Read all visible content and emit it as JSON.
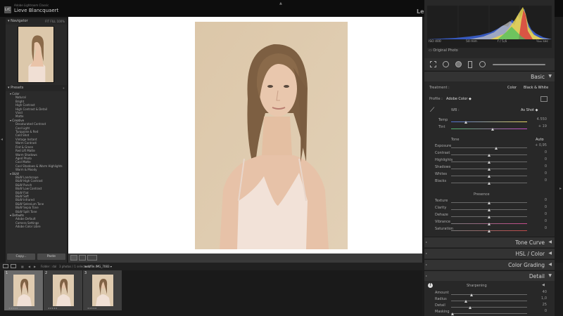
{
  "app": {
    "badge": "LrC",
    "title": "Adobe Lightroom Classic",
    "user": "Lieve Blancquaert",
    "module_hint": "Le"
  },
  "left_panel": {
    "navigator_title": "Navigator",
    "zoom_options": [
      "FIT",
      "FILL",
      "100%"
    ],
    "presets_title": "Presets",
    "groups": [
      {
        "name": "Color",
        "items": [
          "Natural",
          "Bright",
          "High Contrast",
          "High Contrast & Detail",
          "Vivid",
          "Matte"
        ]
      },
      {
        "name": "Creative",
        "items": [
          "Desaturated Contrast",
          "Cool Light",
          "Turquoise & Red",
          "Cold Shot",
          "Vintage Instant",
          "Warm Contrast",
          "Flat & Green",
          "Red Lift Matte",
          "Warm Shadows",
          "Aged Photo",
          "Cool Matte",
          "Cool Shadows & Warm Highlights",
          "Warm & Moody"
        ]
      },
      {
        "name": "B&W",
        "items": [
          "B&W Landscape",
          "B&W High Contrast",
          "B&W Punch",
          "B&W Low Contrast",
          "B&W Flat",
          "B&W Soft",
          "B&W Infrared",
          "B&W Selenium Tone",
          "B&W Sepia Tone",
          "B&W Split Tone"
        ]
      },
      {
        "name": "Defaults",
        "items": [
          "Adobe Default",
          "Camera Settings",
          "Adobe Color Libre"
        ]
      }
    ],
    "copy_label": "Copy...",
    "paste_label": "Paste"
  },
  "filmstrip_bar": {
    "folder_label": "Folder : dal",
    "count_text": "3 photos / 1 selected /",
    "filename": "webfile.IMG_7083 ▾"
  },
  "filmstrip": {
    "thumbs": [
      {
        "index": "1",
        "selected": true,
        "stars": "★★★★★"
      },
      {
        "index": "2",
        "selected": false,
        "stars": "★★★★★"
      },
      {
        "index": "3",
        "selected": false,
        "stars": "★★★★★"
      }
    ]
  },
  "right_panel": {
    "exif": {
      "iso": "ISO 400",
      "focal": "50 mm",
      "aperture": "f / 5,6",
      "shutter": "¹⁄₁₀₀ sec"
    },
    "original_photo": "Original Photo",
    "basic": {
      "title": "Basic",
      "treatment_label": "Treatment :",
      "color_btn": "Color",
      "bw_btn": "Black & White",
      "profile_label": "Profile :",
      "profile_value": "Adobe Color ◆",
      "wb_label": "WB :",
      "wb_value": "As Shot ◆",
      "tone_label": "Tone",
      "auto_label": "Auto",
      "presence_label": "Presence",
      "sliders_wb": [
        {
          "label": "Temp",
          "value": "4.550",
          "pos": 0.2
        },
        {
          "label": "Tint",
          "value": "+ 19",
          "pos": 0.55
        }
      ],
      "sliders_tone": [
        {
          "label": "Exposure",
          "value": "+ 0,95",
          "pos": 0.6
        },
        {
          "label": "Contrast",
          "value": "0",
          "pos": 0.5
        },
        {
          "label": "Highlights",
          "value": "0",
          "pos": 0.5
        },
        {
          "label": "Shadows",
          "value": "0",
          "pos": 0.5
        },
        {
          "label": "Whites",
          "value": "0",
          "pos": 0.5
        },
        {
          "label": "Blacks",
          "value": "0",
          "pos": 0.5
        }
      ],
      "sliders_presence": [
        {
          "label": "Texture",
          "value": "0",
          "pos": 0.5
        },
        {
          "label": "Clarity",
          "value": "0",
          "pos": 0.5
        },
        {
          "label": "Dehaze",
          "value": "0",
          "pos": 0.5
        },
        {
          "label": "Vibrance",
          "value": "0",
          "pos": 0.5
        },
        {
          "label": "Saturation",
          "value": "0",
          "pos": 0.5
        }
      ]
    },
    "sections": [
      "Tone Curve",
      "HSL / Color",
      "Color Grading",
      "Detail"
    ],
    "detail": {
      "sharpening_label": "Sharpening",
      "sliders": [
        {
          "label": "Amount",
          "value": "40",
          "pos": 0.27
        },
        {
          "label": "Radius",
          "value": "1,0",
          "pos": 0.2
        },
        {
          "label": "Detail",
          "value": "25",
          "pos": 0.25
        },
        {
          "label": "Masking",
          "value": "0",
          "pos": 0.02
        }
      ]
    }
  },
  "colors": {
    "panel_bg": "#282828",
    "canvas_bg": "#ffffff",
    "photo_bg": "#dbc6a9"
  }
}
